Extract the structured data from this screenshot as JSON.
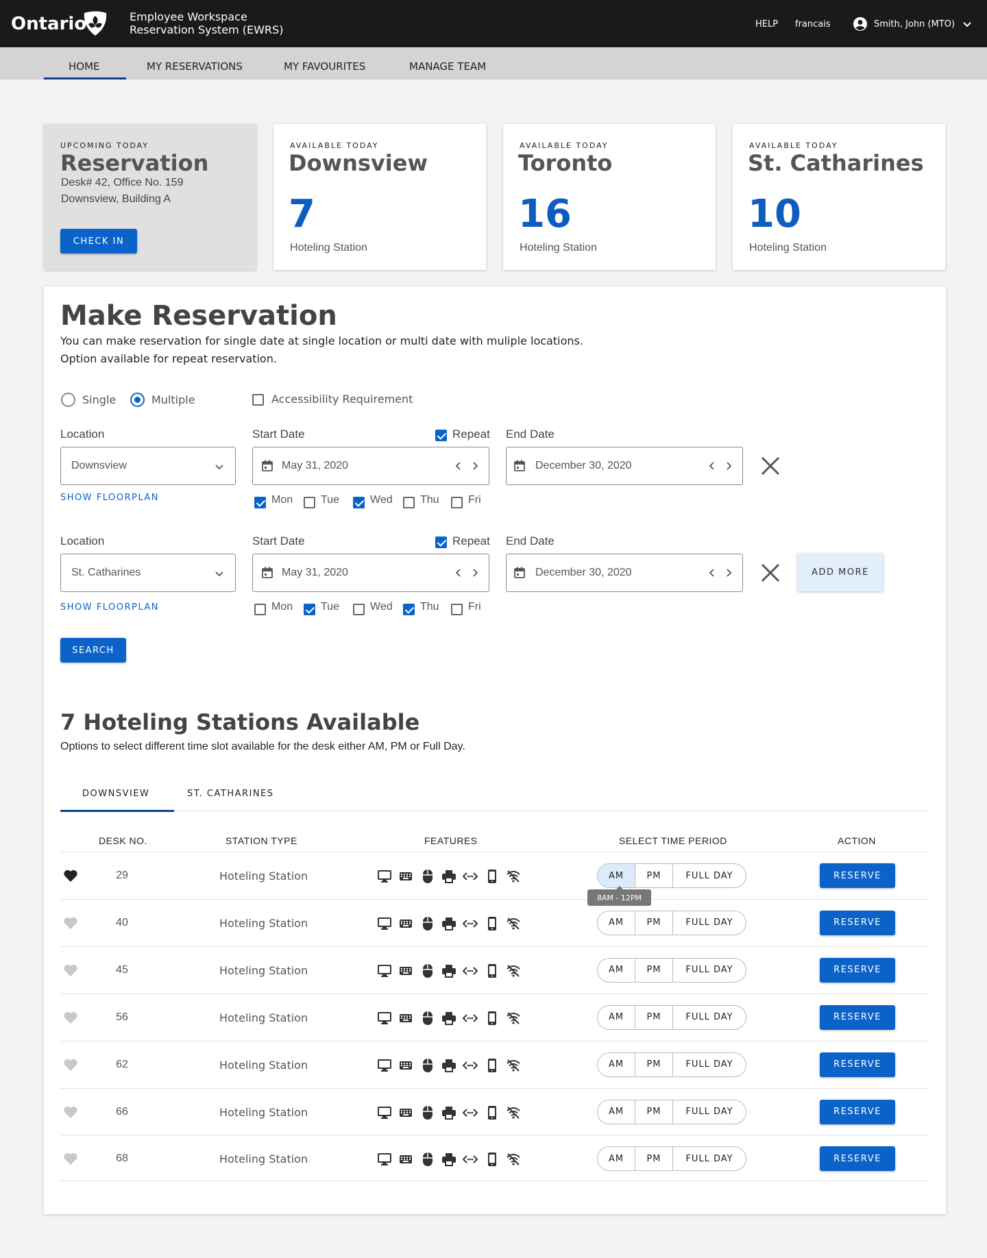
{
  "header": {
    "logo": "Ontario",
    "app_title_line1": "Employee Workspace",
    "app_title_line2": "Reservation System (EWRS)",
    "help": "HELP",
    "language": "francais",
    "user": "Smith, John (MTO)"
  },
  "nav": {
    "items": [
      "HOME",
      "MY RESERVATIONS",
      "MY FAVOURITES",
      "MANAGE TEAM"
    ],
    "active": "HOME"
  },
  "upcoming": {
    "kicker": "UPCOMING TODAY",
    "title": "Reservation",
    "line1": "Desk# 42, Office No. 159",
    "line2": "Downsview, Building A",
    "button": "CHECK IN"
  },
  "availability": [
    {
      "kicker": "AVAILABLE TODAY",
      "location": "Downsview",
      "count": "7",
      "label": "Hoteling Station"
    },
    {
      "kicker": "AVAILABLE TODAY",
      "location": "Toronto",
      "count": "16",
      "label": "Hoteling Station"
    },
    {
      "kicker": "AVAILABLE TODAY",
      "location": "St. Catharines",
      "count": "10",
      "label": "Hoteling Station"
    }
  ],
  "make_reservation": {
    "title": "Make Reservation",
    "desc_line1": "You can make reservation for single date at single location or multi date with muliple locations.",
    "desc_line2": "Option available for repeat reservation.",
    "mode_single": "Single",
    "mode_multiple": "Multiple",
    "mode_selected": "Multiple",
    "accessibility": "Accessibility Requirement",
    "accessibility_checked": false,
    "location_label": "Location",
    "start_label": "Start Date",
    "repeat_label": "Repeat",
    "end_label": "End Date",
    "floorplan_link": "SHOW FLOORPLAN",
    "add_more": "ADD MORE",
    "search": "SEARCH",
    "rows": [
      {
        "location": "Downsview",
        "start": "May 31, 2020",
        "end": "December 30, 2020",
        "repeat": true,
        "days": [
          {
            "label": "Mon",
            "checked": true
          },
          {
            "label": "Tue",
            "checked": false
          },
          {
            "label": "Wed",
            "checked": true
          },
          {
            "label": "Thu",
            "checked": false
          },
          {
            "label": "Fri",
            "checked": false
          }
        ]
      },
      {
        "location": "St. Catharines",
        "start": "May 31, 2020",
        "end": "December 30, 2020",
        "repeat": true,
        "days": [
          {
            "label": "Mon",
            "checked": false
          },
          {
            "label": "Tue",
            "checked": true
          },
          {
            "label": "Wed",
            "checked": false
          },
          {
            "label": "Thu",
            "checked": true
          },
          {
            "label": "Fri",
            "checked": false
          }
        ]
      }
    ]
  },
  "results": {
    "title": "7 Hoteling Stations Available",
    "subtitle": "Options to select different time slot available for the desk either AM, PM or Full Day.",
    "tabs": [
      "DOWNSVIEW",
      "ST. CATHARINES"
    ],
    "active_tab": "DOWNSVIEW",
    "columns": [
      "DESK NO.",
      "STATION TYPE",
      "FEATURES",
      "SELECT TIME PERIOD",
      "ACTION"
    ],
    "features": [
      "monitor-icon",
      "keyboard-icon",
      "mouse-icon",
      "printer-icon",
      "network-icon",
      "phone-icon",
      "wifi-off-icon"
    ],
    "slot_am": "AM",
    "slot_pm": "PM",
    "slot_full": "FULL DAY",
    "reserve": "RESERVE",
    "tooltip": "8AM - 12PM",
    "rows": [
      {
        "desk": "29",
        "type": "Hoteling Station",
        "favourite": true,
        "selected_slot": "AM"
      },
      {
        "desk": "40",
        "type": "Hoteling Station",
        "favourite": false,
        "selected_slot": ""
      },
      {
        "desk": "45",
        "type": "Hoteling Station",
        "favourite": false,
        "selected_slot": ""
      },
      {
        "desk": "56",
        "type": "Hoteling Station",
        "favourite": false,
        "selected_slot": ""
      },
      {
        "desk": "62",
        "type": "Hoteling Station",
        "favourite": false,
        "selected_slot": ""
      },
      {
        "desk": "66",
        "type": "Hoteling Station",
        "favourite": false,
        "selected_slot": ""
      },
      {
        "desk": "68",
        "type": "Hoteling Station",
        "favourite": false,
        "selected_slot": ""
      }
    ]
  },
  "colors": {
    "primary": "#0b63c9",
    "header_bg": "#1a1a1a",
    "nav_bg": "#d4d4d4",
    "favourite_on": "#222222",
    "favourite_off": "#c8c8c8"
  }
}
